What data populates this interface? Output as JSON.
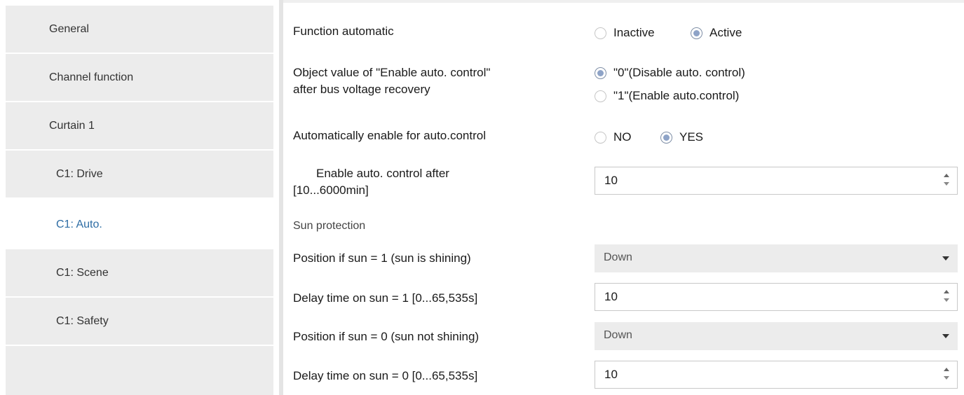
{
  "sidebar": {
    "items": [
      {
        "label": "General"
      },
      {
        "label": "Channel function"
      },
      {
        "label": "Curtain 1"
      },
      {
        "label": "C1: Drive"
      },
      {
        "label": "C1: Auto."
      },
      {
        "label": "C1: Scene"
      },
      {
        "label": "C1: Safety"
      }
    ],
    "active_item": "C1: Auto."
  },
  "content": {
    "function_automatic": {
      "label": "Function automatic",
      "options": [
        "Inactive",
        "Active"
      ],
      "selected": "Active"
    },
    "object_value": {
      "label_line1": "Object value of \"Enable auto. control\"",
      "label_line2": "after bus voltage recovery",
      "options": [
        "\"0\"(Disable auto. control)",
        "\"1\"(Enable auto.control)"
      ],
      "selected": "\"0\"(Disable auto. control)"
    },
    "auto_enable": {
      "label": "Automatically enable for auto.control",
      "options": [
        "NO",
        "YES"
      ],
      "selected": "YES"
    },
    "enable_after": {
      "label_line1": "Enable auto. control after",
      "label_line2": "[10...6000min]",
      "value": "10"
    },
    "sun_protection_label": "Sun protection",
    "position_sun1": {
      "label": "Position if sun = 1  (sun is shining)",
      "value": "Down"
    },
    "delay_sun1": {
      "label": "Delay time on sun = 1  [0...65,535s]",
      "value": "10"
    },
    "position_sun0": {
      "label": "Position if sun = 0  (sun not shining)",
      "value": "Down"
    },
    "delay_sun0": {
      "label": "Delay time on sun = 0   [0...65,535s]",
      "value": "10"
    }
  },
  "colors": {
    "active_nav_text": "#2e6da4",
    "nav_background": "#ececec",
    "radio_fill": "#8ea3c7"
  }
}
